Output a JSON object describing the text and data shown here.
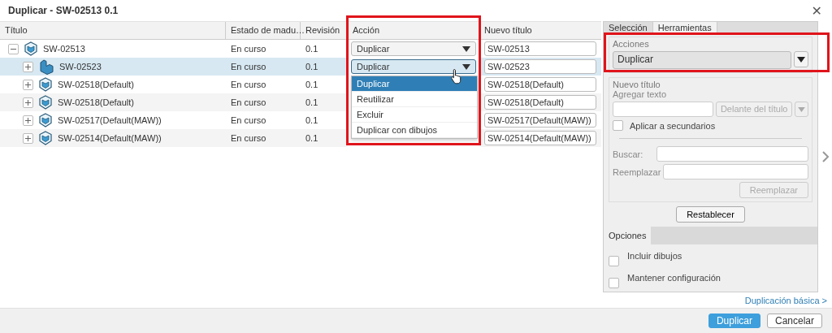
{
  "window": {
    "title": "Duplicar - SW-02513 0.1",
    "close": "✕"
  },
  "table": {
    "columns": [
      {
        "label": "Título"
      },
      {
        "label": "Estado de madu…"
      },
      {
        "label": "Revisión"
      },
      {
        "label": "Acción",
        "highlighted": true
      },
      {
        "label": "Nuevo título"
      }
    ],
    "rows": [
      {
        "title": "SW-02513",
        "kind": "assembly",
        "expanded": true,
        "selected": false,
        "state": "En curso",
        "revision": "0.1",
        "action": "Duplicar",
        "new_title": "SW-02513",
        "children": [
          {
            "title": "SW-02523",
            "kind": "part",
            "expanded": false,
            "selected": true,
            "state": "En curso",
            "revision": "0.1",
            "action": "Duplicar",
            "new_title": "SW-02523",
            "dropdown_open": true
          },
          {
            "title": "SW-02518(Default)",
            "kind": "assembly",
            "expanded": false,
            "selected": false,
            "state": "En curso",
            "revision": "0.1",
            "new_title": "SW-02518(Default)"
          },
          {
            "title": "SW-02518(Default)",
            "kind": "assembly",
            "expanded": false,
            "selected": false,
            "state": "En curso",
            "revision": "0.1",
            "new_title": "SW-02518(Default)"
          },
          {
            "title": "SW-02517(Default(MAW))",
            "kind": "assembly",
            "expanded": false,
            "selected": false,
            "state": "En curso",
            "revision": "0.1",
            "new_title": "SW-02517(Default(MAW))"
          },
          {
            "title": "SW-02514(Default(MAW))",
            "kind": "assembly",
            "expanded": false,
            "selected": false,
            "state": "En curso",
            "revision": "0.1",
            "new_title": "SW-02514(Default(MAW))"
          }
        ]
      }
    ]
  },
  "dropdown_options": [
    {
      "label": "Duplicar",
      "selected": true
    },
    {
      "label": "Reutilizar",
      "selected": false
    },
    {
      "label": "Excluir",
      "selected": false
    },
    {
      "label": "Duplicar con dibujos",
      "selected": false
    }
  ],
  "panel": {
    "tabs": [
      {
        "label": "Selección",
        "selected": false
      },
      {
        "label": "Herramientas",
        "selected": true
      }
    ],
    "actions": {
      "legend": "Acciones",
      "value": "Duplicar",
      "highlighted": true
    },
    "new_title": {
      "legend": "Nuevo título",
      "add_text_label": "Agregar texto",
      "position": "Delante del título",
      "apply_children": {
        "label": "Aplicar a secundarios",
        "checked": false
      },
      "search_label": "Buscar:",
      "replace_label": "Reemplazar",
      "replace_button": "Reemplazar"
    },
    "reset_button": "Restablecer",
    "options_tab": "Opciones",
    "options": [
      {
        "label": "Incluir dibujos",
        "checked": false
      },
      {
        "label": "Mantener configuración",
        "checked": false
      }
    ]
  },
  "basic_link": "Duplicación básica >",
  "buttons": [
    {
      "label": "Duplicar",
      "kind": "primary"
    },
    {
      "label": "Cancelar",
      "kind": "secondary"
    }
  ]
}
